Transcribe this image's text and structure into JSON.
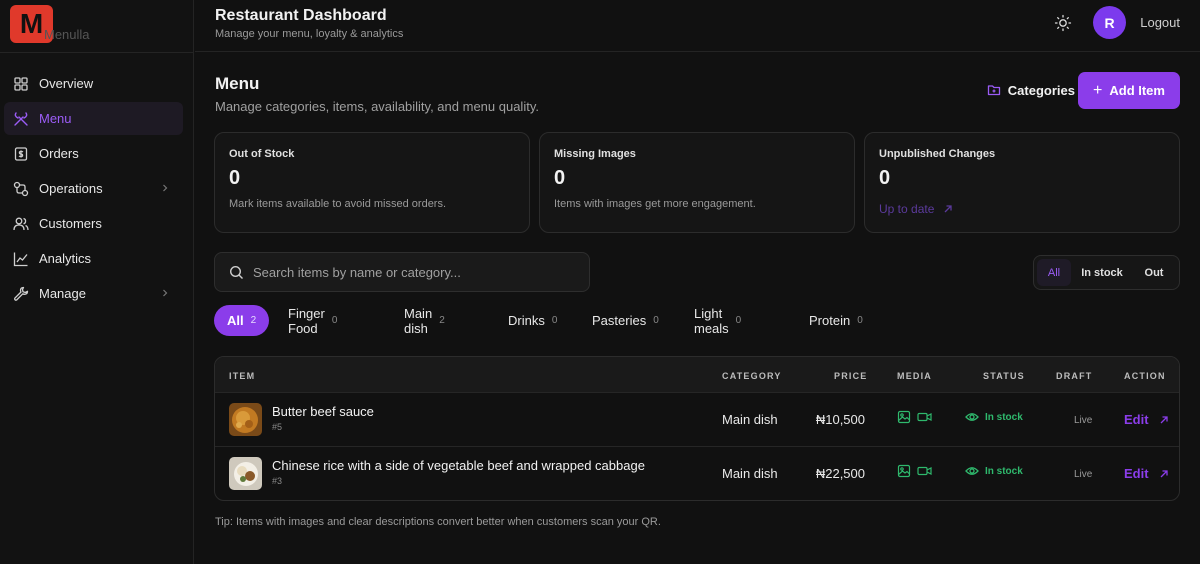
{
  "app": {
    "logo_letter": "M",
    "name": "Menulla"
  },
  "sidebar": {
    "items": [
      {
        "label": "Overview",
        "icon": "grid-icon"
      },
      {
        "label": "Menu",
        "icon": "utensils-icon"
      },
      {
        "label": "Orders",
        "icon": "receipt-icon"
      },
      {
        "label": "Operations",
        "icon": "workflow-icon"
      },
      {
        "label": "Customers",
        "icon": "users-icon"
      },
      {
        "label": "Analytics",
        "icon": "line-chart-icon"
      },
      {
        "label": "Manage",
        "icon": "wrench-icon"
      }
    ],
    "active": "Menu"
  },
  "header": {
    "title": "Restaurant Dashboard",
    "subtitle": "Manage your menu, loyalty & analytics",
    "avatar_initial": "R",
    "logout_label": "Logout"
  },
  "page": {
    "title": "Menu",
    "subtitle": "Manage categories, items, availability, and menu quality.",
    "categories_label": "Categories",
    "add_item_label": "Add Item"
  },
  "cards": [
    {
      "label": "Out of Stock",
      "value": "0",
      "description": "Mark items available to avoid missed orders."
    },
    {
      "label": "Missing Images",
      "value": "0",
      "description": "Items with images get more engagement."
    },
    {
      "label": "Unpublished Changes",
      "value": "0",
      "link": "Up to date"
    }
  ],
  "search": {
    "placeholder": "Search items by name or category..."
  },
  "stock_filter": {
    "options": [
      "All",
      "In stock",
      "Out"
    ],
    "selected": "All"
  },
  "category_chips": [
    {
      "label": "All",
      "count": "2"
    },
    {
      "label": "Finger Food",
      "count": "0"
    },
    {
      "label": "Main dish",
      "count": "2"
    },
    {
      "label": "Drinks",
      "count": "0"
    },
    {
      "label": "Pasteries",
      "count": "0"
    },
    {
      "label": "Light meals",
      "count": "0"
    },
    {
      "label": "Protein",
      "count": "0"
    }
  ],
  "table": {
    "headers": {
      "item": "ITEM",
      "category": "CATEGORY",
      "price": "PRICE",
      "media": "MEDIA",
      "status": "STATUS",
      "draft": "DRAFT",
      "action": "ACTION"
    },
    "rows": [
      {
        "name": "Butter beef sauce",
        "id": "#5",
        "category": "Main dish",
        "price": "₦10,500",
        "status": "In stock",
        "draft": "Live",
        "action": "Edit"
      },
      {
        "name": "Chinese rice with a side of vegetable beef and wrapped cabbage",
        "id": "#3",
        "category": "Main dish",
        "price": "₦22,500",
        "status": "In stock",
        "draft": "Live",
        "action": "Edit"
      }
    ]
  },
  "tip": "Tip: Items with images and clear descriptions convert better when customers scan your QR.",
  "colors": {
    "accent": "#8b3dea",
    "brand_red": "#e0392b",
    "success": "#2fb96d",
    "background": "#111111"
  }
}
